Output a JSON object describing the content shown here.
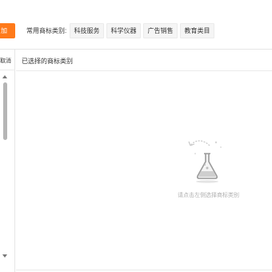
{
  "toolbar": {
    "orange_button_label": "加",
    "common_label": "常用商标类别:",
    "chips": [
      "科技服务",
      "科学仪器",
      "广告销售",
      "教育类目"
    ]
  },
  "left_panel": {
    "header_text": "取消"
  },
  "right_panel": {
    "title": "已选择的商标类别",
    "empty_text": "请点击左侧选择商标类别"
  },
  "colors": {
    "accent": "#ff7a1a",
    "chip_bg": "#f5f5f5",
    "muted_text": "#b0b0b0"
  }
}
